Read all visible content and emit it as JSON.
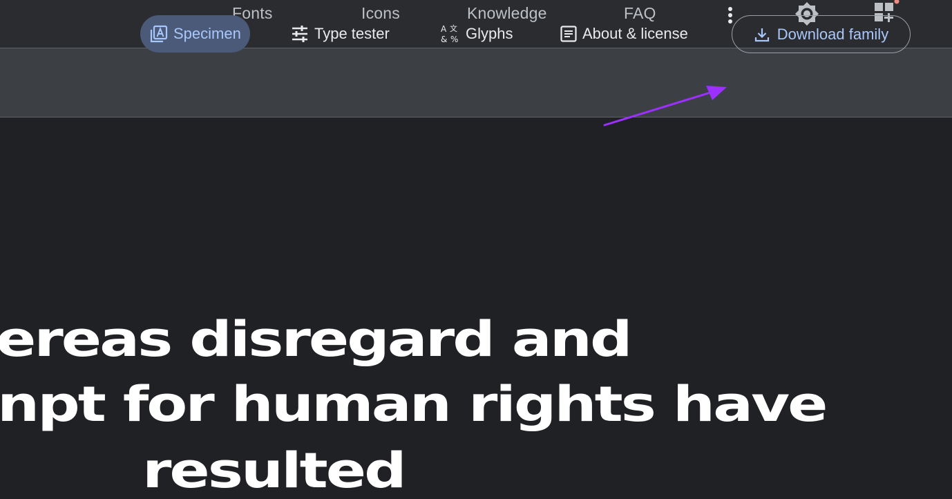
{
  "topnav": {
    "links": [
      "Fonts",
      "Icons",
      "Knowledge",
      "FAQ"
    ],
    "icons": [
      "more-vert-icon",
      "brightness-icon",
      "collection-icon"
    ]
  },
  "toolbar": {
    "tabs": [
      {
        "label": "Specimen",
        "icon": "specimen-icon",
        "active": true
      },
      {
        "label": "Type tester",
        "icon": "tune-icon",
        "active": false
      },
      {
        "label": "Glyphs",
        "icon": "translate-icon",
        "active": false
      },
      {
        "label": "About & license",
        "icon": "article-icon",
        "active": false
      }
    ],
    "download_label": "Download family",
    "download_icon": "download-icon"
  },
  "annotation": {
    "arrow_color": "#9b30ff"
  },
  "specimen": {
    "lines": [
      "ereas disregard and",
      "npt for human rights have",
      "resulted"
    ]
  },
  "colors": {
    "background": "#202124",
    "toolbar": "#3c3f43",
    "accent": "#a8c7fa",
    "active_tab_bg": "#4b5a78"
  }
}
